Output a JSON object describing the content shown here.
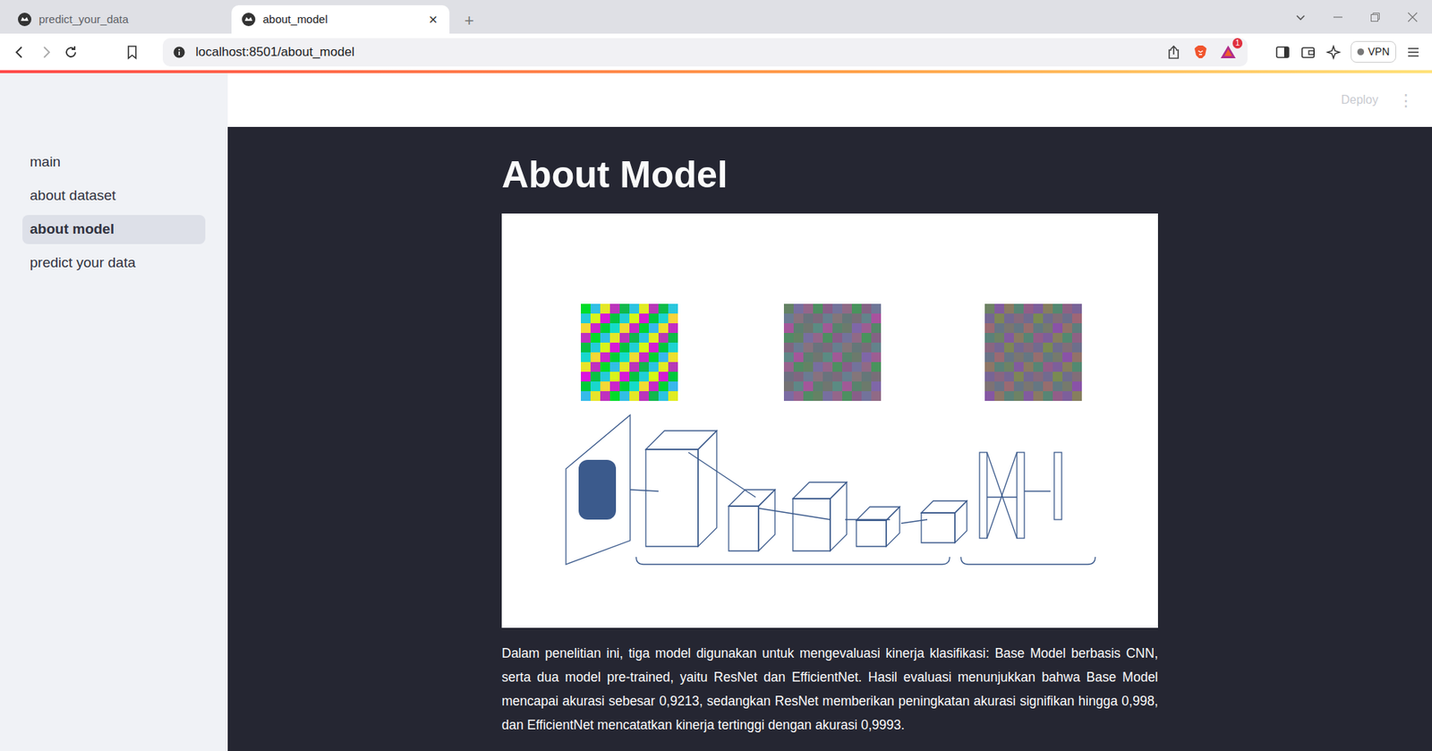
{
  "browser": {
    "tabs": [
      {
        "label": "predict_your_data",
        "selected": false
      },
      {
        "label": "about_model",
        "selected": true
      }
    ],
    "close_tab": "×",
    "new_tab": "+",
    "address": "localhost:8501/about_model",
    "notification_badge": "1",
    "vpn": "VPN"
  },
  "app": {
    "header": {
      "deploy": "Deploy",
      "menu": "⋮"
    },
    "sidebar": {
      "items": [
        {
          "label": "main",
          "selected": false
        },
        {
          "label": "about dataset",
          "selected": false
        },
        {
          "label": "about model",
          "selected": true
        },
        {
          "label": "predict your data",
          "selected": false
        }
      ]
    },
    "title": "About Model",
    "description": "Dalam penelitian ini, tiga model digunakan untuk mengevaluasi kinerja klasifikasi: Base Model berbasis CNN, serta dua model pre-trained, yaitu ResNet dan EfficientNet. Hasil evaluasi menunjukkan bahwa Base Model mencapai akurasi sebesar 0,9213, sedangkan ResNet memberikan peningkatan akurasi signifikan hingga 0,998, dan EfficientNet mencatatkan kinerja tertinggi dengan akurasi 0,9993."
  }
}
